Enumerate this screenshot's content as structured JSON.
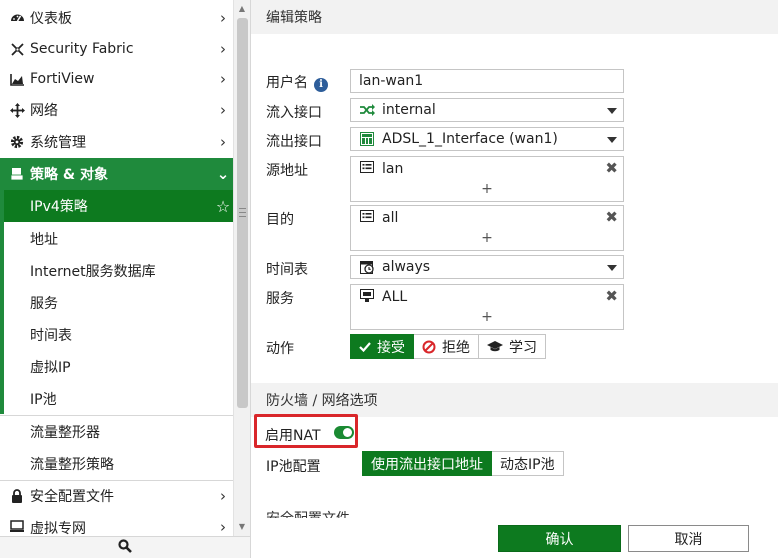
{
  "sidebar": {
    "items": [
      {
        "label": "仪表板",
        "icon": "dashboard-icon"
      },
      {
        "label": "Security Fabric",
        "icon": "security-fabric-icon"
      },
      {
        "label": "FortiView",
        "icon": "fortiview-chart-icon"
      },
      {
        "label": "网络",
        "icon": "network-move-icon"
      },
      {
        "label": "系统管理",
        "icon": "gear-icon"
      },
      {
        "label": "策略 & 对象",
        "icon": "policy-objects-icon"
      },
      {
        "label": "IPv4策略"
      },
      {
        "label": "地址"
      },
      {
        "label": "Internet服务数据库"
      },
      {
        "label": "服务"
      },
      {
        "label": "时间表"
      },
      {
        "label": "虚拟IP"
      },
      {
        "label": "IP池"
      },
      {
        "label": "流量整形器"
      },
      {
        "label": "流量整形策略"
      },
      {
        "label": "安全配置文件",
        "icon": "lock-icon"
      },
      {
        "label": "虚拟专网",
        "icon": "vpn-monitor-icon"
      }
    ],
    "search_icon": "search-icon"
  },
  "main": {
    "header": "编辑策略",
    "fields": {
      "username": {
        "label": "用户名",
        "value": "lan-wan1"
      },
      "incoming": {
        "label": "流入接口",
        "value": "internal",
        "icon": "shuffle-icon"
      },
      "outgoing": {
        "label": "流出接口",
        "value": "ADSL_1_Interface (wan1)",
        "icon": "interface-port-icon"
      },
      "source": {
        "label": "源地址",
        "value": "lan",
        "icon": "address-list-icon",
        "add": "+",
        "remove": "✖"
      },
      "destination": {
        "label": "目的",
        "value": "all",
        "icon": "address-list-icon",
        "add": "+",
        "remove": "✖"
      },
      "schedule": {
        "label": "时间表",
        "value": "always",
        "icon": "schedule-clock-icon"
      },
      "service": {
        "label": "服务",
        "value": "ALL",
        "icon": "service-monitor-icon",
        "add": "+",
        "remove": "✖"
      }
    },
    "action": {
      "label": "动作",
      "options": [
        {
          "label": "接受",
          "icon": "check-icon",
          "selected": true
        },
        {
          "label": "拒绝",
          "icon": "deny-icon",
          "selected": false
        },
        {
          "label": "学习",
          "icon": "learn-icon",
          "selected": false
        }
      ]
    },
    "firewall_section": "防火墙 / 网络选项",
    "nat": {
      "label": "启用NAT",
      "enabled": true
    },
    "ippool": {
      "label": "IP池配置",
      "options": [
        {
          "label": "使用流出接口地址",
          "selected": true
        },
        {
          "label": "动态IP池",
          "selected": false
        }
      ]
    },
    "next_section": "安全配置文件"
  },
  "footer": {
    "ok": "确认",
    "cancel": "取消"
  },
  "colors": {
    "brand_green": "#0d7a1f",
    "highlight_red": "#d9262a",
    "info_blue": "#2d5d9a"
  }
}
